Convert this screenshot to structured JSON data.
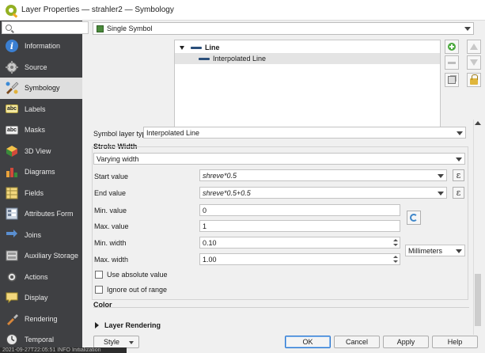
{
  "window": {
    "title": "Layer Properties — strahler2 — Symbology"
  },
  "sidebar": {
    "search_placeholder": "",
    "items": [
      {
        "label": "Information",
        "icon": "info-icon",
        "color": "#3b7fd1"
      },
      {
        "label": "Source",
        "icon": "source-icon",
        "color": "#c9c9c9"
      },
      {
        "label": "Symbology",
        "icon": "symbology-icon",
        "color": "#8c8c8c"
      },
      {
        "label": "Labels",
        "icon": "labels-icon",
        "color": "#f3e8a0"
      },
      {
        "label": "Masks",
        "icon": "masks-icon",
        "color": "#f0f0f0"
      },
      {
        "label": "3D View",
        "icon": "3d-view-icon",
        "color": "#e9a23b"
      },
      {
        "label": "Diagrams",
        "icon": "diagrams-icon",
        "color": "#d24a3a"
      },
      {
        "label": "Fields",
        "icon": "fields-icon",
        "color": "#5a8fd1"
      },
      {
        "label": "Attributes Form",
        "icon": "attributes-form-icon",
        "color": "#cfd8e4"
      },
      {
        "label": "Joins",
        "icon": "joins-icon",
        "color": "#5a8fd1"
      },
      {
        "label": "Auxiliary Storage",
        "icon": "auxiliary-storage-icon",
        "color": "#d7d7d7"
      },
      {
        "label": "Actions",
        "icon": "actions-icon",
        "color": "#e0e0e0"
      },
      {
        "label": "Display",
        "icon": "display-icon",
        "color": "#f2d77d"
      },
      {
        "label": "Rendering",
        "icon": "rendering-icon",
        "color": "#d7863b"
      },
      {
        "label": "Temporal",
        "icon": "temporal-icon",
        "color": "#e8e8e8"
      }
    ],
    "active_index": 2
  },
  "renderer": {
    "label": "Single Symbol"
  },
  "tree": {
    "root": "Line",
    "child": "Interpolated Line"
  },
  "symbol_layer": {
    "type_label": "Symbol layer type",
    "type_value": "Interpolated Line"
  },
  "stroke": {
    "title": "Stroke Width",
    "mode": "Varying width",
    "start_label": "Start value",
    "start_value": "shreve*0.5",
    "end_label": "End value",
    "end_value": "shreve*0.5+0.5",
    "min_value_label": "Min. value",
    "min_value": "0",
    "max_value_label": "Max. value",
    "max_value": "1",
    "min_width_label": "Min. width",
    "min_width": "0.10",
    "max_width_label": "Max. width",
    "max_width": "1.00",
    "unit": "Millimeters",
    "abs_label": "Use absolute value",
    "ignore_label": "Ignore out of range"
  },
  "color_section": {
    "title": "Color"
  },
  "layer_rendering": {
    "title": "Layer Rendering"
  },
  "buttons": {
    "style": "Style",
    "ok": "OK",
    "cancel": "Cancel",
    "apply": "Apply",
    "help": "Help"
  },
  "status": {
    "text": "2021-09-27T22:05:51  INFO  Initialization"
  }
}
